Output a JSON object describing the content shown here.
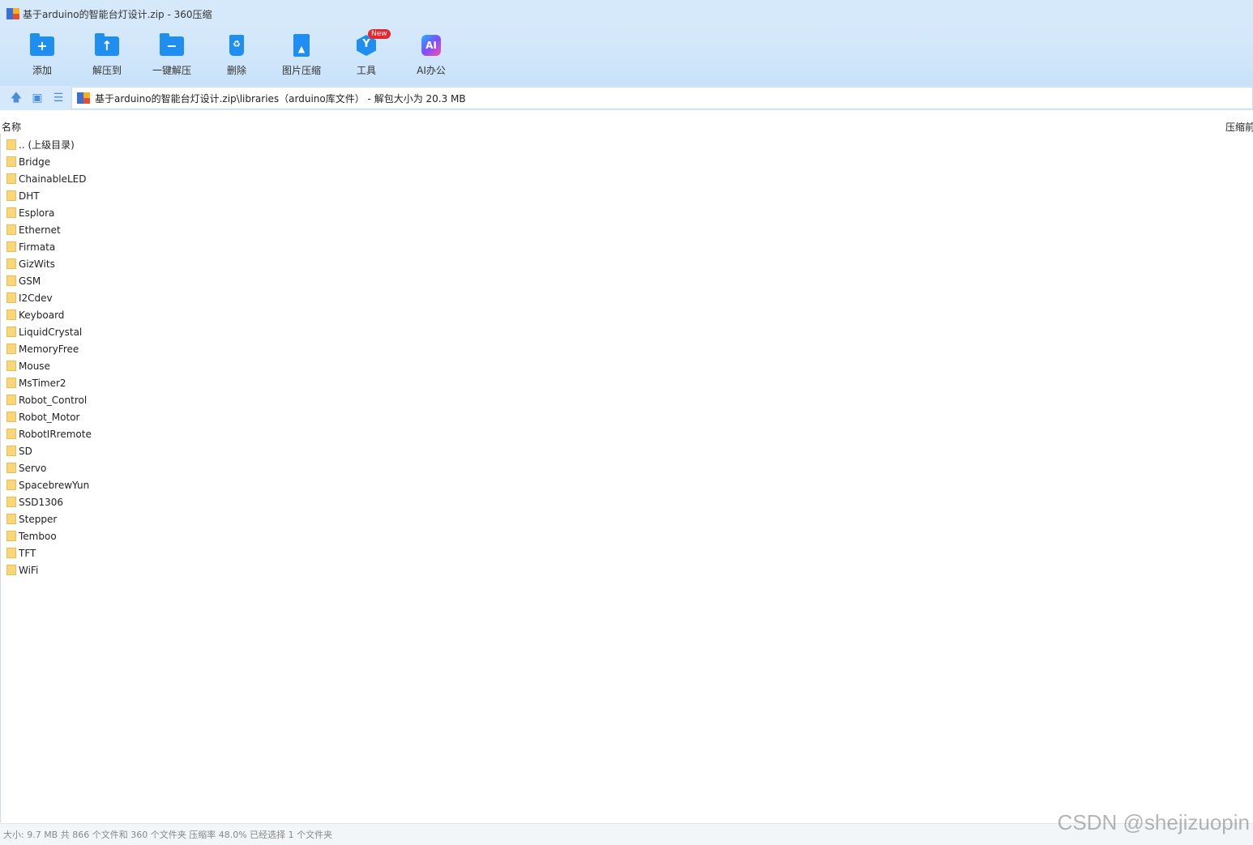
{
  "window": {
    "title": "基于arduino的智能台灯设计.zip - 360压缩"
  },
  "toolbar": {
    "add": "添加",
    "extract_to": "解压到",
    "one_click_extract": "一键解压",
    "delete": "删除",
    "image_compress": "图片压缩",
    "tools": "工具",
    "tools_badge": "New",
    "ai_office": "AI办公",
    "ai_icon_text": "AI"
  },
  "address": {
    "path": "基于arduino的智能台灯设计.zip\\libraries（arduino库文件） - 解包大小为 20.3 MB"
  },
  "columns": {
    "name": "名称",
    "size": "压缩前"
  },
  "files": [
    ".. (上级目录)",
    "Bridge",
    "ChainableLED",
    "DHT",
    "Esplora",
    "Ethernet",
    "Firmata",
    "GizWits",
    "GSM",
    "I2Cdev",
    "Keyboard",
    "LiquidCrystal",
    "MemoryFree",
    "Mouse",
    "MsTimer2",
    "Robot_Control",
    "Robot_Motor",
    "RobotIRremote",
    "SD",
    "Servo",
    "SpacebrewYun",
    "SSD1306",
    "Stepper",
    "Temboo",
    "TFT",
    "WiFi"
  ],
  "status": {
    "text": "大小: 9.7 MB 共 866 个文件和 360 个文件夹 压缩率 48.0% 已经选择 1 个文件夹"
  },
  "watermark": "CSDN @shejizuopin",
  "icons": [
    "app-icon",
    "add-folder-icon",
    "extract-to-icon",
    "one-click-extract-icon",
    "recycle-bin-icon",
    "image-compress-icon",
    "tools-icon",
    "ai-office-icon",
    "up-arrow-icon",
    "view-icon",
    "list-view-icon",
    "folder-icon"
  ]
}
